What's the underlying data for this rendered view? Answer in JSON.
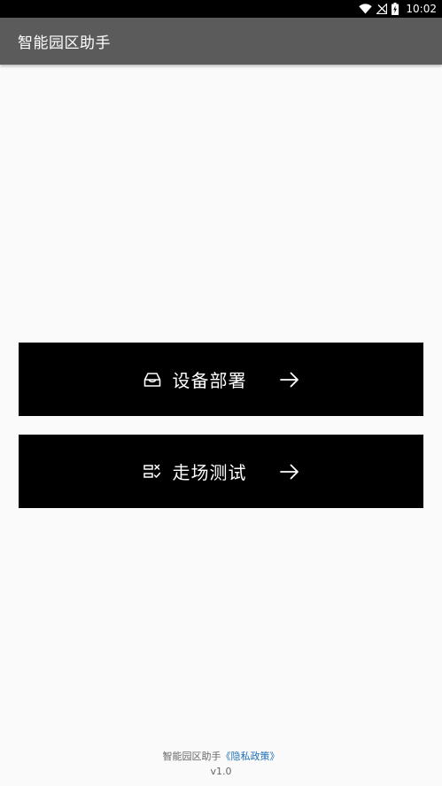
{
  "status_bar": {
    "time": "10:02",
    "icons": [
      "wifi-icon",
      "no-signal-icon",
      "battery-charging-icon"
    ]
  },
  "app_bar": {
    "title": "智能园区助手"
  },
  "buttons": {
    "deploy": {
      "label": "设备部署",
      "icon": "device-icon"
    },
    "walk_test": {
      "label": "走场测试",
      "icon": "checklist-icon"
    }
  },
  "footer": {
    "app_name": "智能园区助手",
    "privacy_link": "《隐私政策》",
    "version": "v1.0"
  },
  "colors": {
    "status_bar_bg": "#000000",
    "app_bar_bg": "#5b5b5b",
    "background": "#fafafa",
    "button_bg": "#000000",
    "link": "#1e6fb4"
  }
}
